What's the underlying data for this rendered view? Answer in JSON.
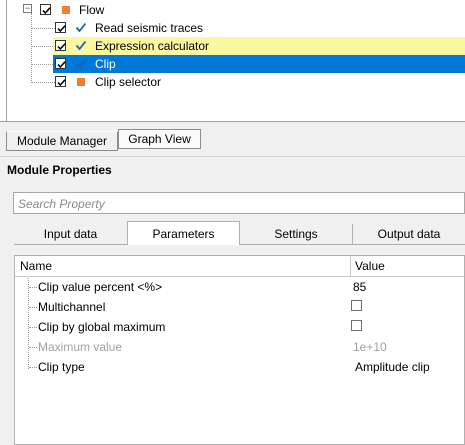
{
  "tree": {
    "items": [
      {
        "label": "Flow",
        "checked": true,
        "icon": "orange-square-icon"
      },
      {
        "label": "Read seismic traces",
        "checked": true,
        "icon": "blue-check-icon"
      },
      {
        "label": "Expression calculator",
        "checked": true,
        "icon": "blue-check-icon",
        "highlight": "yellow"
      },
      {
        "label": "Clip",
        "checked": true,
        "icon": "blue-check-icon",
        "selected": true
      },
      {
        "label": "Clip selector",
        "checked": true,
        "icon": "orange-square-icon"
      }
    ],
    "collapse_glyph": "−"
  },
  "bottom_tabs": {
    "module_manager": "Module Manager",
    "graph_view": "Graph View"
  },
  "panel": {
    "title": "Module Properties",
    "search_placeholder": "Search Property"
  },
  "prop_tabs": {
    "input_data": "Input data",
    "parameters": "Parameters",
    "settings": "Settings",
    "output_data": "Output data"
  },
  "grid": {
    "header": {
      "name": "Name",
      "value": "Value"
    },
    "rows": [
      {
        "name": "Clip value percent <%>",
        "value": "85"
      },
      {
        "name": "Multichannel",
        "value": "",
        "checkbox": true
      },
      {
        "name": "Clip by global maximum",
        "value": "",
        "checkbox": true
      },
      {
        "name": "Maximum value",
        "value": "1e+10",
        "disabled": true
      },
      {
        "name": "Clip type",
        "value": "Amplitude clip"
      }
    ]
  },
  "colors": {
    "selected_row": "#0078d7",
    "highlight_row": "#fbf7a0",
    "orange_icon": "#ef7f2c",
    "check_blue": "#1f5fb4",
    "disabled_text": "#a0a0a0"
  }
}
